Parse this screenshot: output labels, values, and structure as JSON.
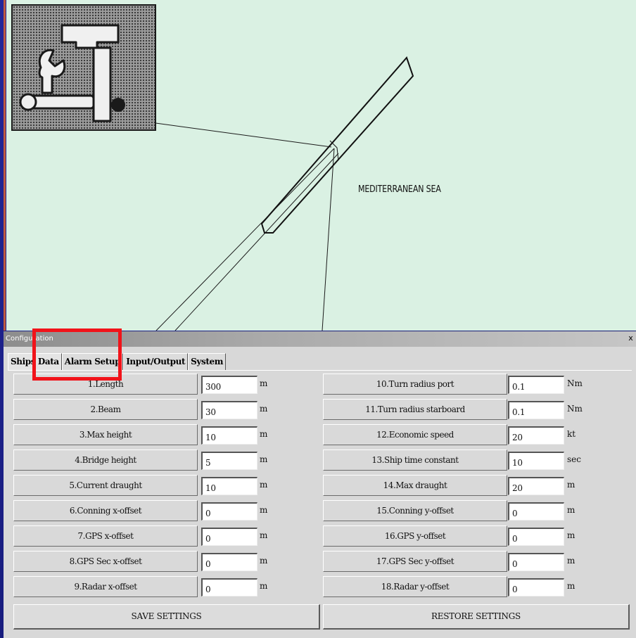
{
  "map": {
    "sea_label": "MEDITERRANEAN SEA",
    "background": "#daf1e3"
  },
  "dialog": {
    "title": "Configuration",
    "close_label": "x",
    "tabs": [
      {
        "label": "Ships Data",
        "active": true
      },
      {
        "label": "Alarm Setup",
        "active": false
      },
      {
        "label": "Input/Output",
        "active": false
      },
      {
        "label": "System",
        "active": false
      }
    ],
    "left_fields": [
      {
        "label": "1.Length",
        "value": "300",
        "unit": "m"
      },
      {
        "label": "2.Beam",
        "value": "30",
        "unit": "m"
      },
      {
        "label": "3.Max height",
        "value": "10",
        "unit": "m"
      },
      {
        "label": "4.Bridge height",
        "value": "5",
        "unit": "m"
      },
      {
        "label": "5.Current draught",
        "value": "10",
        "unit": "m"
      },
      {
        "label": "6.Conning x-offset",
        "value": "0",
        "unit": "m"
      },
      {
        "label": "7.GPS x-offset",
        "value": "0",
        "unit": "m"
      },
      {
        "label": "8.GPS Sec x-offset",
        "value": "0",
        "unit": "m"
      },
      {
        "label": "9.Radar x-offset",
        "value": "0",
        "unit": "m"
      }
    ],
    "right_fields": [
      {
        "label": "10.Turn radius port",
        "value": "0.1",
        "unit": "Nm"
      },
      {
        "label": "11.Turn radius starboard",
        "value": "0.1",
        "unit": "Nm"
      },
      {
        "label": "12.Economic speed",
        "value": "20",
        "unit": "kt"
      },
      {
        "label": "13.Ship time constant",
        "value": "10",
        "unit": "sec"
      },
      {
        "label": "14.Max draught",
        "value": "20",
        "unit": "m"
      },
      {
        "label": "15.Conning y-offset",
        "value": "0",
        "unit": "m"
      },
      {
        "label": "16.GPS y-offset",
        "value": "0",
        "unit": "m"
      },
      {
        "label": "17.GPS Sec y-offset",
        "value": "0",
        "unit": "m"
      },
      {
        "label": "18.Radar y-offset",
        "value": "0",
        "unit": "m"
      }
    ],
    "save_label": "SAVE SETTINGS",
    "restore_label": "RESTORE SETTINGS"
  },
  "colors": {
    "highlight": "#f1131a",
    "background": "#1d1f8c"
  }
}
